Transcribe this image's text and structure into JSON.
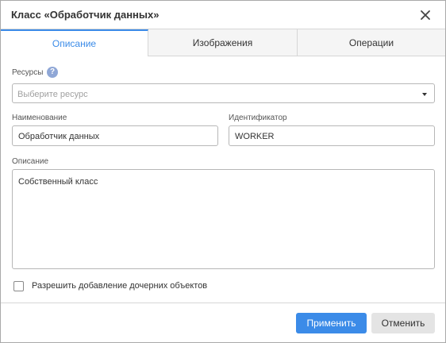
{
  "dialog": {
    "title": "Класс «Обработчик данных»",
    "close_icon": "close-icon"
  },
  "tabs": [
    {
      "label": "Описание",
      "active": true
    },
    {
      "label": "Изображения",
      "active": false
    },
    {
      "label": "Операции",
      "active": false
    }
  ],
  "form": {
    "resources": {
      "label": "Ресурсы",
      "help_icon": "help-icon",
      "help_glyph": "?",
      "placeholder": "Выберите ресурс",
      "value": ""
    },
    "name": {
      "label": "Наименование",
      "value": "Обработчик данных"
    },
    "identifier": {
      "label": "Идентификатор",
      "value": "WORKER"
    },
    "description": {
      "label": "Описание",
      "value": "Собственный класс"
    },
    "allow_children": {
      "label": "Разрешить добавление дочерних объектов",
      "checked": false
    }
  },
  "footer": {
    "apply_label": "Применить",
    "cancel_label": "Отменить"
  },
  "colors": {
    "accent": "#3b8be8",
    "help_icon": "#8fa7d6",
    "secondary_button": "#e4e4e4",
    "border": "#b7b7b7"
  }
}
